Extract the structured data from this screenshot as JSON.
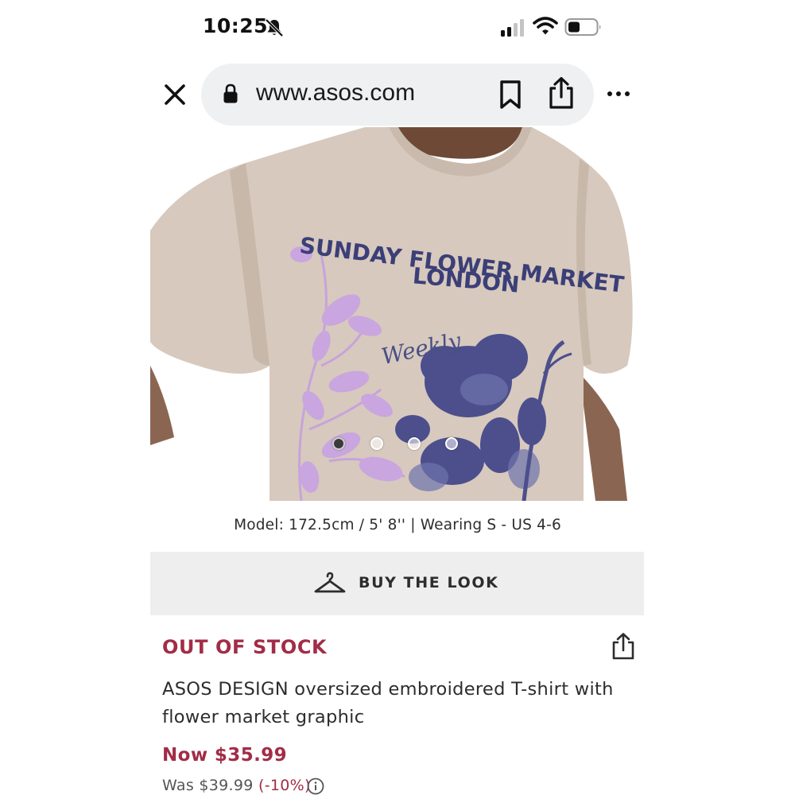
{
  "status_bar": {
    "time": "10:25",
    "icons": [
      "bell-slash-icon",
      "cellular-signal-icon",
      "wifi-icon",
      "battery-icon"
    ]
  },
  "browser": {
    "url": "www.asos.com",
    "icons": [
      "close-icon",
      "lock-icon",
      "bookmark-icon",
      "share-icon",
      "more-icon"
    ]
  },
  "product_image": {
    "print_line1": "SUNDAY FLOWER MARKET",
    "print_line2": "LONDON",
    "print_script": "Weekly",
    "carousel_count": 4,
    "carousel_active": 0
  },
  "model_info": "Model: 172.5cm / 5' 8'' | Wearing S - US 4-6",
  "buy_the_look": {
    "label": "BUY THE LOOK",
    "icon": "hanger-icon"
  },
  "product": {
    "stock_status": "OUT OF STOCK",
    "title": "ASOS DESIGN oversized embroidered T-shirt with flower market graphic",
    "price_now": "Now $35.99",
    "price_was": "Was $39.99",
    "discount": "(-10%)"
  },
  "colors": {
    "accent": "#a12d47",
    "tshirt": "#d7c9bd",
    "print_navy": "#3b3f78",
    "print_lilac": "#c7a3dc",
    "button_bg": "#eeeeee",
    "url_bar_bg": "#eef0f1"
  }
}
